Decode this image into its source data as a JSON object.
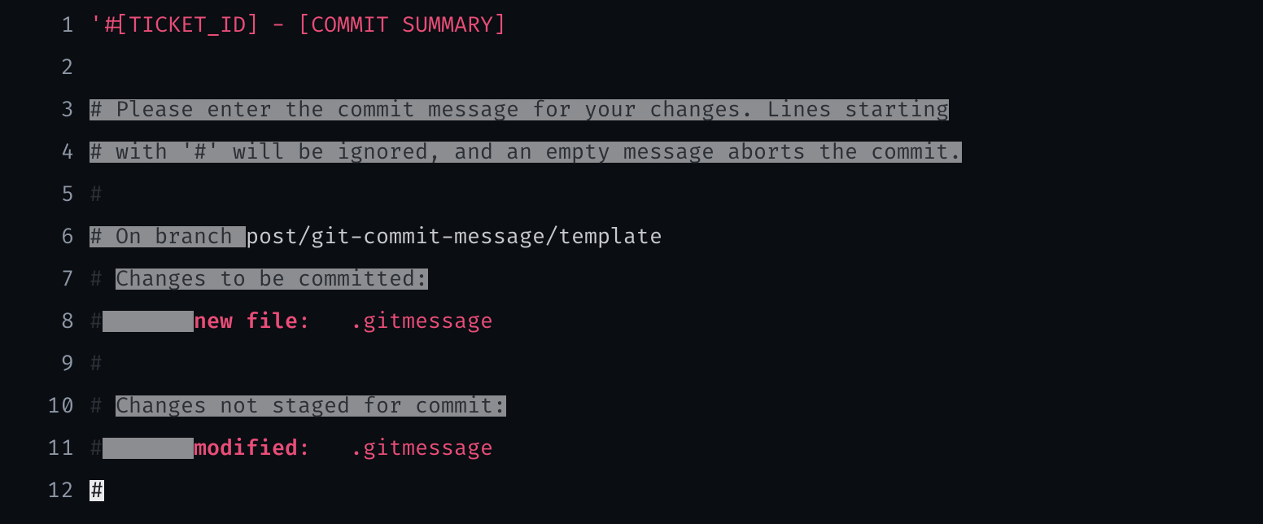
{
  "lines": {
    "n1": "1",
    "n2": "2",
    "n3": "3",
    "n4": "4",
    "n5": "5",
    "n6": "6",
    "n7": "7",
    "n8": "8",
    "n9": "9",
    "n10": "10",
    "n11": "11",
    "n12": "12"
  },
  "l1": {
    "quote": "'",
    "text": "#[TICKET_ID] - [COMMIT SUMMARY]"
  },
  "l3": {
    "full": "# Please enter the commit message for your changes. Lines starting"
  },
  "l4": {
    "full": "# with '#' will be ignored, and an empty message aborts the commit."
  },
  "l5": {
    "hash": "#"
  },
  "l6": {
    "prefix": "# On branch ",
    "branch": "post/git-commit-message/template"
  },
  "l7": {
    "hash": "# ",
    "text": "Changes to be committed:"
  },
  "l8": {
    "hash": "#",
    "pad1": "       ",
    "status": "new file",
    "colon_pad": ":   ",
    "file": ".gitmessage"
  },
  "l9": {
    "hash": "#"
  },
  "l10": {
    "hash": "# ",
    "text": "Changes not staged for commit:"
  },
  "l11": {
    "hash": "#",
    "pad1": "       ",
    "status": "modified",
    "colon_pad": ":   ",
    "file": ".gitmessage"
  },
  "l12": {
    "hash": "#"
  }
}
